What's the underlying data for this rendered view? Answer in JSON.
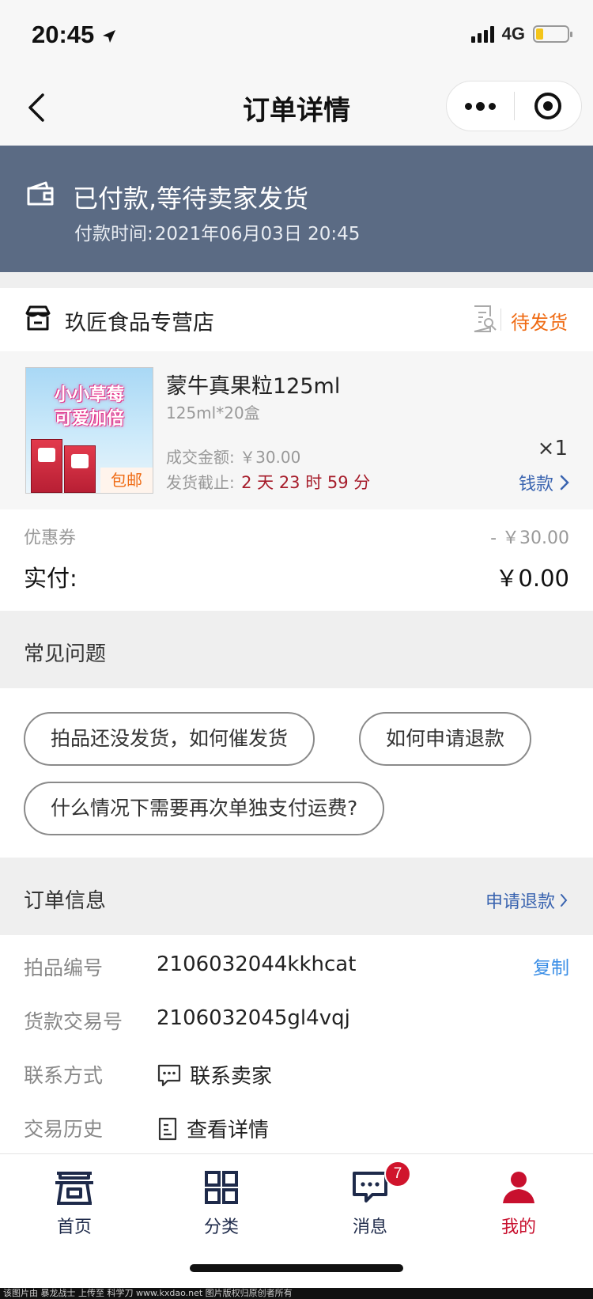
{
  "status_bar": {
    "time": "20:45",
    "network": "4G"
  },
  "nav": {
    "title": "订单详情"
  },
  "banner": {
    "title": "已付款,等待卖家发货",
    "pay_time_label": "付款时间:",
    "pay_time": "2021年06月03日 20:45"
  },
  "store": {
    "name": "玖匠食品专营店",
    "order_state": "待发货",
    "state_color": "#ef6b14"
  },
  "product": {
    "image_line1": "小小草莓",
    "image_line2": "可爱加倍",
    "image_tag": "包邮",
    "name": "蒙牛真果粒125ml",
    "spec": "125ml*20盒",
    "deal_label": "成交金额:",
    "deal_amount": "￥30.00",
    "deadline_label": "发货截止:",
    "deadline_countdown": "2 天 23 时 59 分",
    "quantity": "×1",
    "money_link": "钱款"
  },
  "totals": {
    "coupon_label": "优惠券",
    "coupon_value": "- ￥30.00",
    "paid_label": "实付:",
    "paid_value": "￥0.00"
  },
  "faq": {
    "title": "常见问题",
    "questions": [
      "拍品还没发货，如何催发货",
      "如何申请退款",
      "什么情况下需要再次单独支付运费?"
    ]
  },
  "order_info": {
    "title": "订单信息",
    "refund_link": "申请退款",
    "rows": [
      {
        "label": "拍品编号",
        "value": "2106032044kkhcat",
        "action": "复制"
      },
      {
        "label": "货款交易号",
        "value": "2106032045gl4vqj"
      },
      {
        "label": "联系方式",
        "value": "联系卖家"
      },
      {
        "label": "交易历史",
        "value": "查看详情"
      }
    ]
  },
  "tabbar": {
    "items": [
      {
        "label": "首页"
      },
      {
        "label": "分类"
      },
      {
        "label": "消息",
        "badge": "7"
      },
      {
        "label": "我的"
      }
    ],
    "active_color": "#c8102e"
  },
  "footer_watermark": "该图片由 暴龙战士 上传至 科学刀 www.kxdao.net 图片版权归原创者所有",
  "colors": {
    "banner_bg": "#5b6b84",
    "link_blue": "#3a64b0",
    "copy_blue": "#3a8ee6",
    "countdown_red": "#a61c2a"
  }
}
